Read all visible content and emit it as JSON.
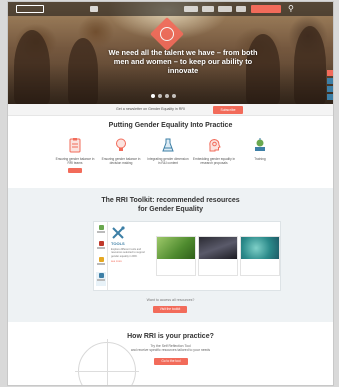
{
  "hero": {
    "headline": "We need all the talent we have – from both men and women – to keep our ability to innovate",
    "slide_count": 4,
    "active_slide": 1
  },
  "nav": {
    "links": [
      "",
      "",
      "",
      ""
    ],
    "cta_label": "",
    "search_icon": "search-icon"
  },
  "subscribe": {
    "text": "Get a newsletter on Gender Equality in RRI",
    "button_label": "Subscribe"
  },
  "features": {
    "title": "Putting Gender Equality Into Practice",
    "items": [
      {
        "label": "Ensuring gender balance in RRI teams",
        "icon": "clipboard-icon",
        "has_button": true
      },
      {
        "label": "Ensuring gender balance in decision making",
        "icon": "lightbulb-icon",
        "has_button": false
      },
      {
        "label": "Integrating gender dimension in R&I content",
        "icon": "flask-icon",
        "has_button": false
      },
      {
        "label": "Embedding gender equality in research proposals",
        "icon": "head-gear-icon",
        "has_button": false
      },
      {
        "label": "Training",
        "icon": "apple-book-icon",
        "has_button": false
      }
    ]
  },
  "toolkit": {
    "title_line1": "The RRI Toolkit: recommended resources",
    "title_line2": "for Gender Equality",
    "side_items": [
      "",
      "",
      "",
      ""
    ],
    "main_label": "TOOLS",
    "main_desc": "Explore different tools and resources selected to support gender equality in RRI.",
    "main_more": "see more",
    "cards": [
      {
        "caption": ""
      },
      {
        "caption": ""
      },
      {
        "caption": ""
      }
    ],
    "question": "Want to access all resources?",
    "button_label": "Visit the toolkit"
  },
  "rri": {
    "title": "How RRI is your practice?",
    "subtitle_line1": "Try the Self Reflection Tool",
    "subtitle_line2": "and receive specific resources tailored to your needs",
    "button_label": "Go to the tool"
  },
  "colors": {
    "accent": "#f26b5a",
    "blue": "#3d7fa6",
    "green": "#6aa84f"
  }
}
